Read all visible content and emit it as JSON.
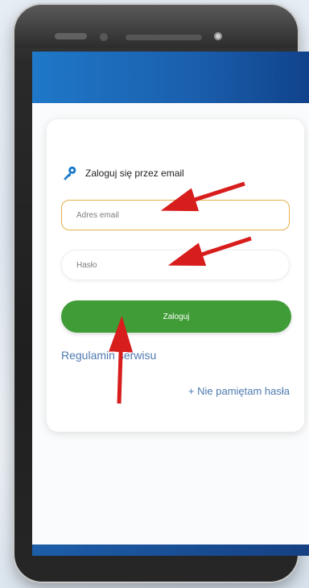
{
  "screen": {
    "title": "Zaloguj się przez email",
    "email_placeholder": "Adres email",
    "password_placeholder": "Hasło",
    "login_label": "Zaloguj",
    "terms_text": "Regulamin serwisu",
    "forgot_text": "+ Nie pamiętam hasła"
  },
  "icons": {
    "title_icon": "key-icon"
  },
  "colors": {
    "header_blue": "#1f78c8",
    "button_green": "#3f9c36",
    "email_border": "#e4b04a",
    "link_blue": "#4e79b0",
    "arrow_red": "#d81d1d"
  }
}
